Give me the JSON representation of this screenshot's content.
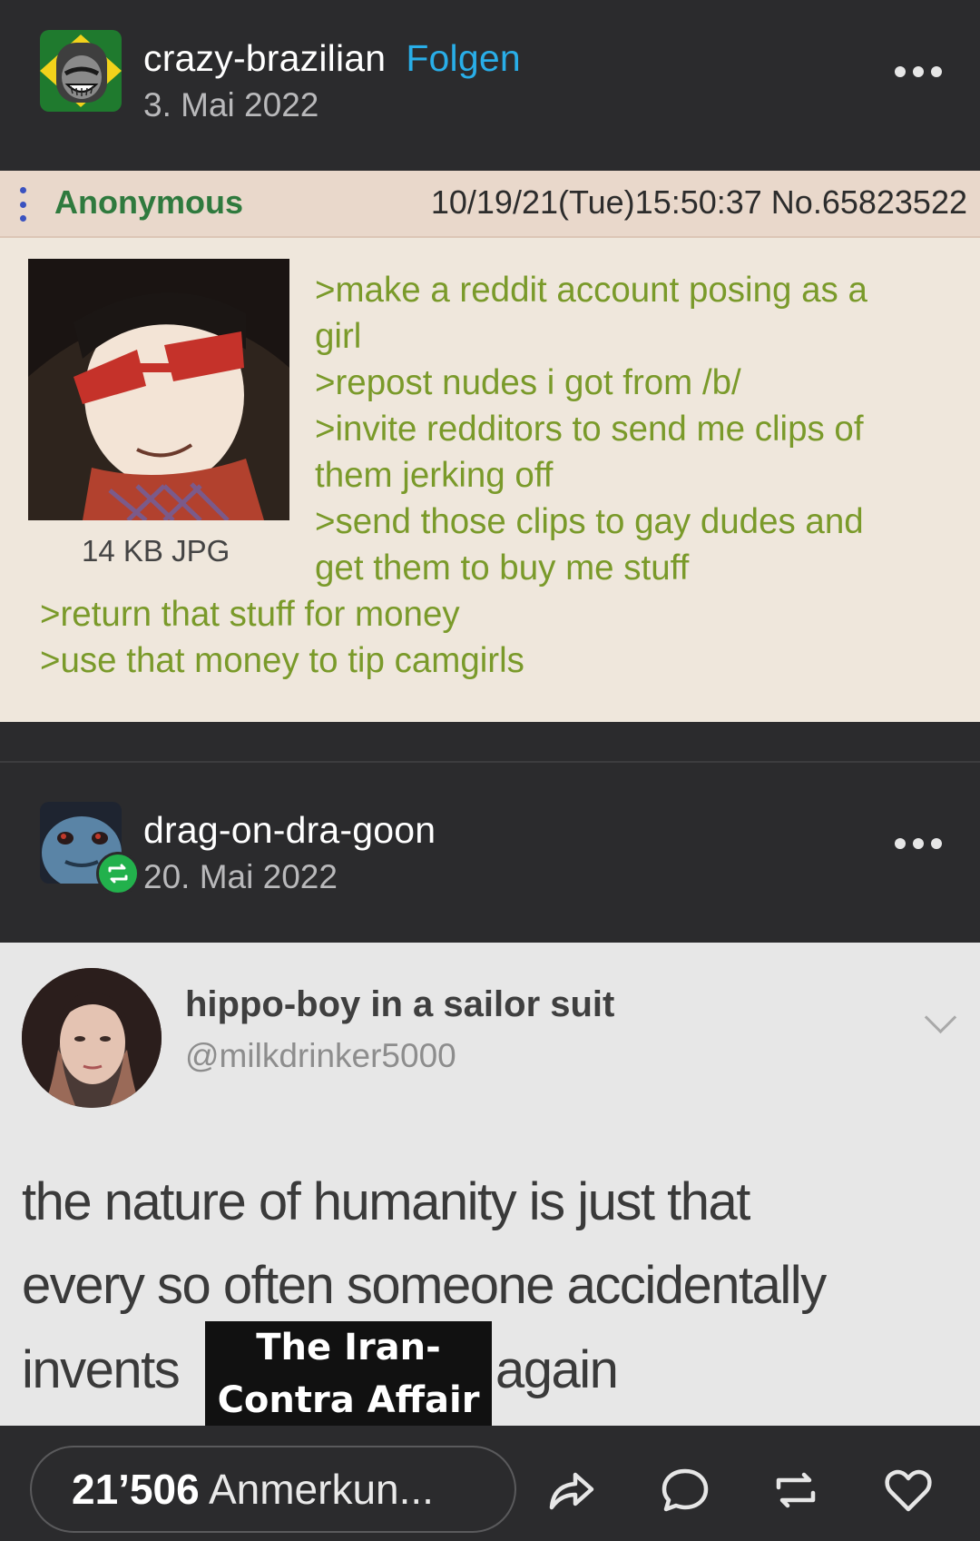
{
  "post1": {
    "username": "crazy-brazilian",
    "follow_label": "Folgen",
    "date": "3. Mai 2022",
    "avatar_icon": "hulk-avatar-icon"
  },
  "chan": {
    "name": "Anonymous",
    "meta": "10/19/21(Tue)15:50:37 No.65823522",
    "file_info": "14 KB JPG",
    "lines": [
      ">make a reddit account posing as a",
      "girl",
      ">repost nudes i got from /b/",
      ">invite redditors to send me clips of",
      "them jerking off",
      ">send those clips to gay dudes and",
      "get them to buy me stuff",
      ">return that stuff for money",
      ">use that money to tip camgirls"
    ]
  },
  "post2": {
    "username": "drag-on-dra-goon",
    "date": "20. Mai 2022",
    "reblog_icon": "reblog-badge-icon"
  },
  "tweet": {
    "name": "hippo-boy in a sailor suit",
    "handle": "@milkdrinker5000",
    "line1": "the nature of humanity is just that",
    "line2": "every so often someone accidentally",
    "line3_start": "invents",
    "line3_end": "again",
    "overlay_line1": "The Iran-",
    "overlay_line2": "Contra Affair"
  },
  "footer": {
    "notes_count": "21’506",
    "notes_label": "Anmerkun...",
    "icons": [
      "share-icon",
      "comment-icon",
      "reblog-icon",
      "like-icon"
    ]
  },
  "colors": {
    "background": "#2b2b2d",
    "follow": "#29aee8",
    "greentext": "#7a9a2a",
    "chan_name": "#2f7a3e"
  }
}
